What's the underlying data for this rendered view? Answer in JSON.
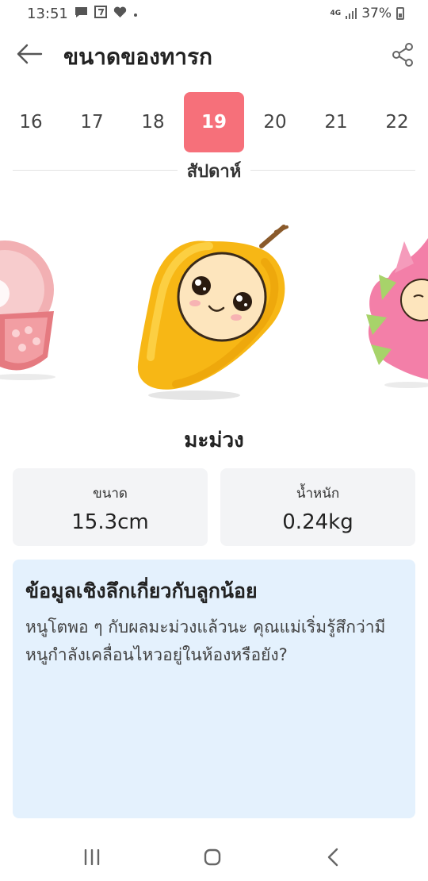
{
  "status": {
    "time": "13:51",
    "network": "4G",
    "battery": "37%"
  },
  "header": {
    "title": "ขนาดของทารก"
  },
  "weeks": {
    "items": [
      "16",
      "17",
      "18",
      "19",
      "20",
      "21",
      "22"
    ],
    "selected": "19",
    "label": "สัปดาห์"
  },
  "fruit": {
    "name": "มะม่วง",
    "size_label": "ขนาด",
    "size_value": "15.3cm",
    "weight_label": "น้ำหนัก",
    "weight_value": "0.24kg"
  },
  "insight": {
    "title": "ข้อมูลเชิงลึกเกี่ยวกับลูกน้อย",
    "text": "หนูโตพอ ๆ กับผลมะม่วงแล้วนะ คุณแม่เริ่มรู้สึกว่ามีหนูกำลังเคลื่อนไหวอยู่ในห้องหรือยัง?"
  },
  "colors": {
    "accent": "#f6707a",
    "insight_bg": "#e4f1fd",
    "card_bg": "#f3f4f6"
  }
}
